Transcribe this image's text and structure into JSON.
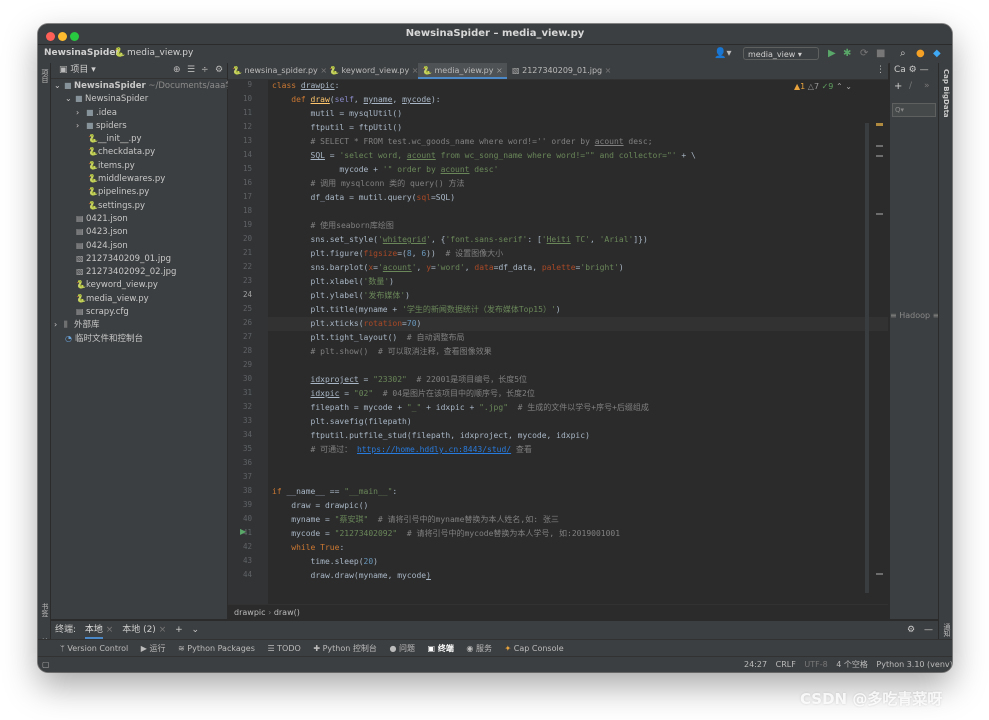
{
  "window": {
    "title": "NewsinaSpider – media_view.py",
    "dot_colors": [
      "#fe5f57",
      "#febc2e",
      "#28c840"
    ]
  },
  "nav": {
    "project": "NewsinaSpider",
    "file": "media_view.py",
    "run_config": "media_view"
  },
  "project_panel": {
    "title": "项目",
    "root_label": "NewsinaSpider",
    "root_path": "~/Documents/aaa学",
    "items": [
      {
        "label": "NewsinaSpider",
        "icon": "folder-icon"
      },
      {
        "label": ".idea",
        "icon": "folder-icon"
      },
      {
        "label": "spiders",
        "icon": "folder-icon"
      },
      {
        "label": "__init__.py",
        "icon": "python-file-icon"
      },
      {
        "label": "checkdata.py",
        "icon": "python-file-icon"
      },
      {
        "label": "items.py",
        "icon": "python-file-icon"
      },
      {
        "label": "middlewares.py",
        "icon": "python-file-icon"
      },
      {
        "label": "pipelines.py",
        "icon": "python-file-icon"
      },
      {
        "label": "settings.py",
        "icon": "python-file-icon"
      },
      {
        "label": "0421.json",
        "icon": "json-file-icon"
      },
      {
        "label": "0423.json",
        "icon": "json-file-icon"
      },
      {
        "label": "0424.json",
        "icon": "json-file-icon"
      },
      {
        "label": "2127340209_01.jpg",
        "icon": "image-file-icon"
      },
      {
        "label": "21273402092_02.jpg",
        "icon": "image-file-icon"
      },
      {
        "label": "keyword_view.py",
        "icon": "python-file-icon"
      },
      {
        "label": "media_view.py",
        "icon": "python-file-icon"
      },
      {
        "label": "scrapy.cfg",
        "icon": "config-file-icon"
      },
      {
        "label": "外部库",
        "icon": "library-icon"
      },
      {
        "label": "临时文件和控制台",
        "icon": "scratch-icon"
      }
    ]
  },
  "tabs": [
    {
      "label": "newsina_spider.py"
    },
    {
      "label": "keyword_view.py"
    },
    {
      "label": "media_view.py"
    },
    {
      "label": "2127340209_01.jpg"
    }
  ],
  "inspections": {
    "warnings": "▲1",
    "weak": "△7",
    "ok": "✓9"
  },
  "line_numbers": [
    "9",
    "10",
    "11",
    "12",
    "13",
    "14",
    "15",
    "16",
    "17",
    "18",
    "19",
    "20",
    "21",
    "22",
    "23",
    "24",
    "25",
    "26",
    "27",
    "28",
    "29",
    "30",
    "31",
    "32",
    "33",
    "34",
    "35",
    "36",
    "37",
    "38",
    "39",
    "40",
    "41",
    "42",
    "43",
    "44"
  ],
  "current_line_index": 15,
  "breadcrumb": {
    "class": "drawpic",
    "method": "draw()"
  },
  "right_panel": {
    "label": "Cap BigData",
    "hadoop": "Hadoop"
  },
  "terminal": {
    "label": "终端:",
    "tab1": "本地",
    "tab2": "本地 (2)"
  },
  "toolbar": [
    "Version Control",
    "运行",
    "Python Packages",
    "TODO",
    "Python 控制台",
    "问题",
    "终端",
    "服务",
    "Cap Console"
  ],
  "status": {
    "position": "24:27",
    "line_sep": "CRLF",
    "encoding": "UTF-8",
    "indent": "4 个空格",
    "interpreter": "Python 3.10 (venv)"
  },
  "watermark": "CSDN @多吃青菜呀"
}
